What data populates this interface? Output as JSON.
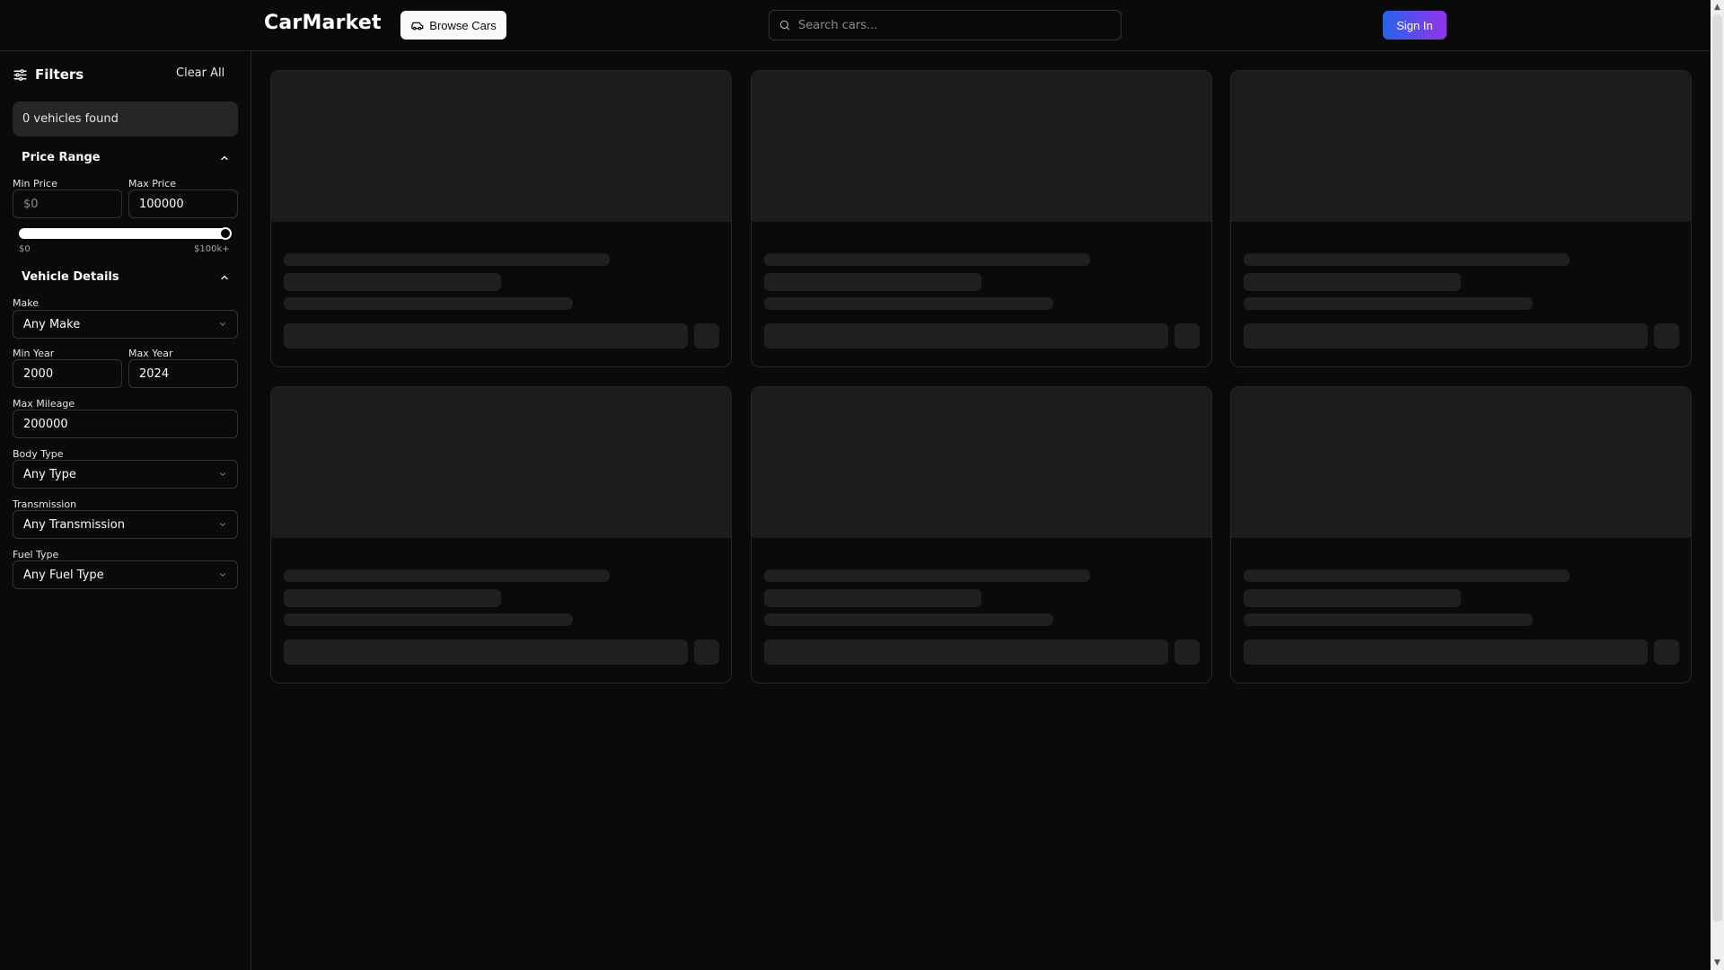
{
  "header": {
    "logo": "CarMarket",
    "browse_label": "Browse Cars",
    "search_placeholder": "Search cars...",
    "signin_label": "Sign In"
  },
  "sidebar": {
    "title": "Filters",
    "clear_all": "Clear All",
    "count_text": "0 vehicles found",
    "price": {
      "heading": "Price Range",
      "min_label": "Min Price",
      "min_placeholder": "$0",
      "max_label": "Max Price",
      "max_value": "100000",
      "range_min_label": "$0",
      "range_max_label": "$100k+",
      "slider_level": 1.0
    },
    "vehicle": {
      "heading": "Vehicle Details",
      "make_label": "Make",
      "make_value": "Any Make",
      "min_year_label": "Min Year",
      "min_year_value": "2000",
      "max_year_label": "Max Year",
      "max_year_value": "2024",
      "mileage_label": "Max Mileage",
      "mileage_value": "200000",
      "body_label": "Body Type",
      "body_value": "Any Type",
      "transmission_label": "Transmission",
      "transmission_value": "Any Transmission",
      "fuel_label": "Fuel Type",
      "fuel_value": "Any Fuel Type"
    }
  },
  "colors": {
    "background": "#0a0a0a",
    "border": "#262626",
    "skeleton": "#1f1f1f",
    "accent_start": "#2563eb",
    "accent_end": "#9333ea"
  },
  "listings": {
    "loading": true,
    "skeleton_count": 6
  }
}
